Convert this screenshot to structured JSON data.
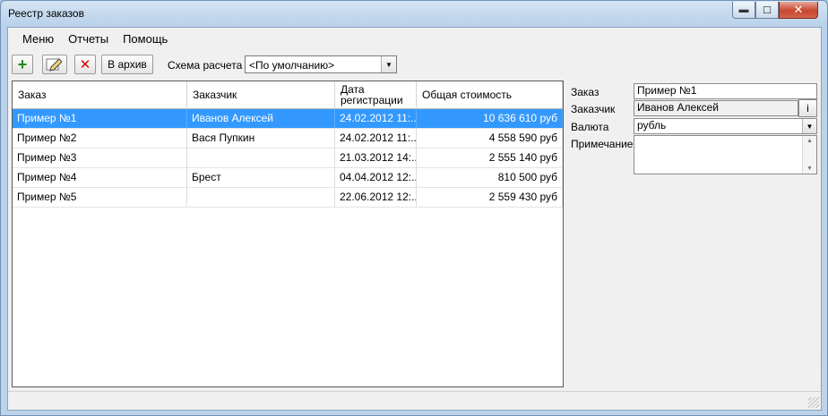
{
  "window": {
    "title": "Реестр заказов",
    "close_glyph": "✕",
    "min_glyph": "▬",
    "max_glyph": "☐"
  },
  "menu": [
    "Меню",
    "Отчеты",
    "Помощь"
  ],
  "toolbar": {
    "add_icon": "plus-icon",
    "edit_icon": "pencil-icon",
    "delete_icon": "delete-x-icon",
    "archive_label": "В архив",
    "scheme_label": "Схема расчета",
    "scheme_value": "<По умолчанию>"
  },
  "grid": {
    "columns": [
      "Заказ",
      "Заказчик",
      "Дата регистрации",
      "Общая стоимость"
    ],
    "rows": [
      {
        "order": "Пример №1",
        "customer": "Иванов Алексей",
        "date": "24.02.2012 11:...",
        "total": "10 636 610 руб"
      },
      {
        "order": "Пример №2",
        "customer": "Вася Пупкин",
        "date": "24.02.2012 11:...",
        "total": "4 558 590 руб"
      },
      {
        "order": "Пример №3",
        "customer": "",
        "date": "21.03.2012 14:...",
        "total": "2 555 140 руб"
      },
      {
        "order": "Пример №4",
        "customer": "Брест",
        "date": "04.04.2012 12:...",
        "total": "810 500 руб"
      },
      {
        "order": "Пример №5",
        "customer": "",
        "date": "22.06.2012 12:...",
        "total": "2 559 430 руб"
      }
    ],
    "selected_row": 0
  },
  "details": {
    "order_label": "Заказ",
    "order_value": "Пример №1",
    "customer_label": "Заказчик",
    "customer_value": "Иванов Алексей",
    "info_button": "i",
    "currency_label": "Валюта",
    "currency_value": "рубль",
    "note_label": "Примечание",
    "note_value": ""
  },
  "colors": {
    "selection": "#3399ff",
    "add_icon": "#1f8a1f",
    "delete_icon": "#d40000"
  }
}
